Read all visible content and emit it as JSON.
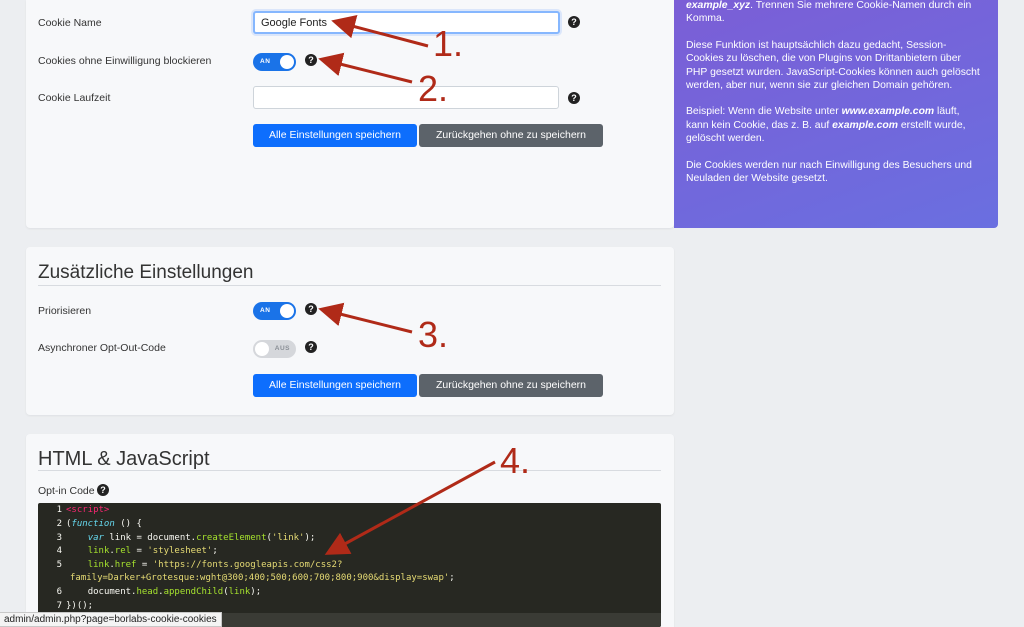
{
  "cookie_settings": {
    "cookie_name_label": "Cookie Name",
    "cookie_name_value": "Google Fonts",
    "block_label": "Cookies ohne Einwilligung blockieren",
    "block_toggle": "AN",
    "lifetime_label": "Cookie Laufzeit",
    "lifetime_value": "",
    "save_label": "Alle Einstellungen speichern",
    "back_label": "Zurückgehen ohne zu speichern"
  },
  "info_panel": {
    "p1_example": "example_xyz",
    "p1_rest": ". Trennen Sie mehrere Cookie-Namen durch ein Komma.",
    "p2": "Diese Funktion ist hauptsächlich dazu gedacht, Session-Cookies zu löschen, die von Plugins von Drittanbietern über PHP gesetzt wurden. JavaScript-Cookies können auch gelöscht werden, aber nur, wenn sie zur gleichen Domain gehören.",
    "p3_a": "Beispiel: Wenn die Website unter ",
    "p3_domain1": "www.example.com",
    "p3_b": " läuft, kann kein Cookie, das z. B. auf ",
    "p3_domain2": "example.com",
    "p3_c": " erstellt wurde, gelöscht werden.",
    "p4": "Die Cookies werden nur nach Einwilligung des Besuchers und Neuladen der Website gesetzt."
  },
  "extra_settings": {
    "title": "Zusätzliche Einstellungen",
    "prioritize_label": "Priorisieren",
    "prioritize_toggle": "AN",
    "async_label": "Asynchroner Opt-Out-Code",
    "async_toggle": "AUS",
    "save_label": "Alle Einstellungen speichern",
    "back_label": "Zurückgehen ohne zu speichern"
  },
  "code_section": {
    "title": "HTML & JavaScript",
    "optin_label": "Opt-in Code",
    "line_numbers": [
      "1",
      "2",
      "3",
      "4",
      "5",
      "6",
      "7"
    ],
    "l1_tag": "<script>",
    "l2_a": "(",
    "l2_kw": "function",
    "l2_b": " () {",
    "l3_kw": "var",
    "l3_var": " link",
    "l3_a": " = document.",
    "l3_fn": "createElement",
    "l3_b": "(",
    "l3_str": "'link'",
    "l3_c": ");",
    "l4_obj": "link",
    "l4_a": ".",
    "l4_prop": "rel",
    "l4_b": " = ",
    "l4_str": "'stylesheet'",
    "l4_c": ";",
    "l5_obj": "link",
    "l5_a": ".",
    "l5_prop": "href",
    "l5_b": " = ",
    "l5_str": "'https://fonts.googleapis.com/css2?",
    "l5_cont": "family=Darker+Grotesque:wght@300;400;500;600;700;800;900&display=swap'",
    "l5_end": ";",
    "l6_a": "document.",
    "l6_prop": "head",
    "l6_b": ".",
    "l6_fn": "appendChild",
    "l6_c": "(",
    "l6_var": "link",
    "l6_d": ");",
    "l7": "})();"
  },
  "annotations": [
    "1.",
    "2.",
    "3.",
    "4."
  ],
  "status_bar": "admin/admin.php?page=borlabs-cookie-cookies",
  "colors": {
    "primary": "#0d6efd",
    "secondary": "#5c636a",
    "annotation": "#b02a18",
    "info_gradient_start": "#7b5ed6",
    "info_gradient_end": "#6a6fe0"
  }
}
